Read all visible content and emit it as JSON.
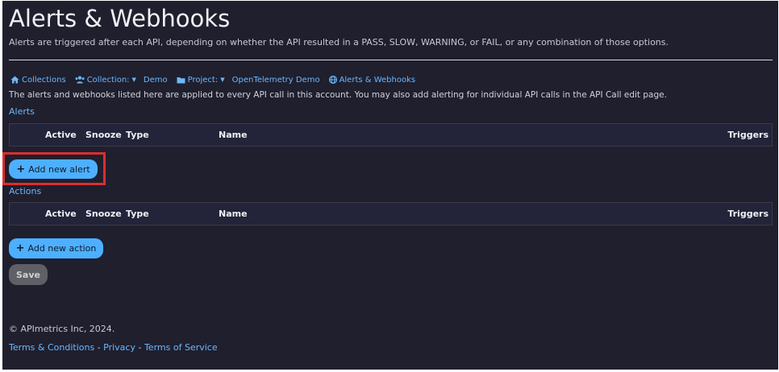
{
  "header": {
    "title": "Alerts & Webhooks",
    "subtitle": "Alerts are triggered after each API, depending on whether the API resulted in a PASS, SLOW, WARNING, or FAIL, or any combination of those options."
  },
  "breadcrumb": {
    "collections": "Collections",
    "collection_label": "Collection:",
    "collection_value": "Demo",
    "project_label": "Project:",
    "project_value": "OpenTelemetry Demo",
    "current": "Alerts & Webhooks"
  },
  "description": "The alerts and webhooks listed here are applied to every API call in this account. You may also add alerting for individual API calls in the API Call edit page.",
  "alerts": {
    "section_label": "Alerts",
    "columns": [
      "Active",
      "Snooze",
      "Type",
      "Name",
      "Triggers"
    ],
    "add_button": "Add new alert"
  },
  "actions": {
    "section_label": "Actions",
    "columns": [
      "Active",
      "Snooze",
      "Type",
      "Name",
      "Triggers"
    ],
    "add_button": "Add new action"
  },
  "save_button": "Save",
  "footer": {
    "copyright": "© APImetrics Inc, 2024.",
    "terms": "Terms & Conditions",
    "sep1": " - ",
    "privacy": "Privacy",
    "sep2": " - ",
    "tos": "Terms of Service"
  },
  "colors": {
    "background": "#1f1f2e",
    "link": "#6bb8ff",
    "button": "#4db0ff",
    "highlight": "#dc2e2e",
    "save_disabled": "#5f5f66"
  },
  "icons": {
    "collections": "home-icon",
    "collection": "users-icon",
    "project": "folder-icon",
    "current": "globe-icon",
    "add": "plus-icon",
    "dropdown": "caret-down-icon"
  }
}
